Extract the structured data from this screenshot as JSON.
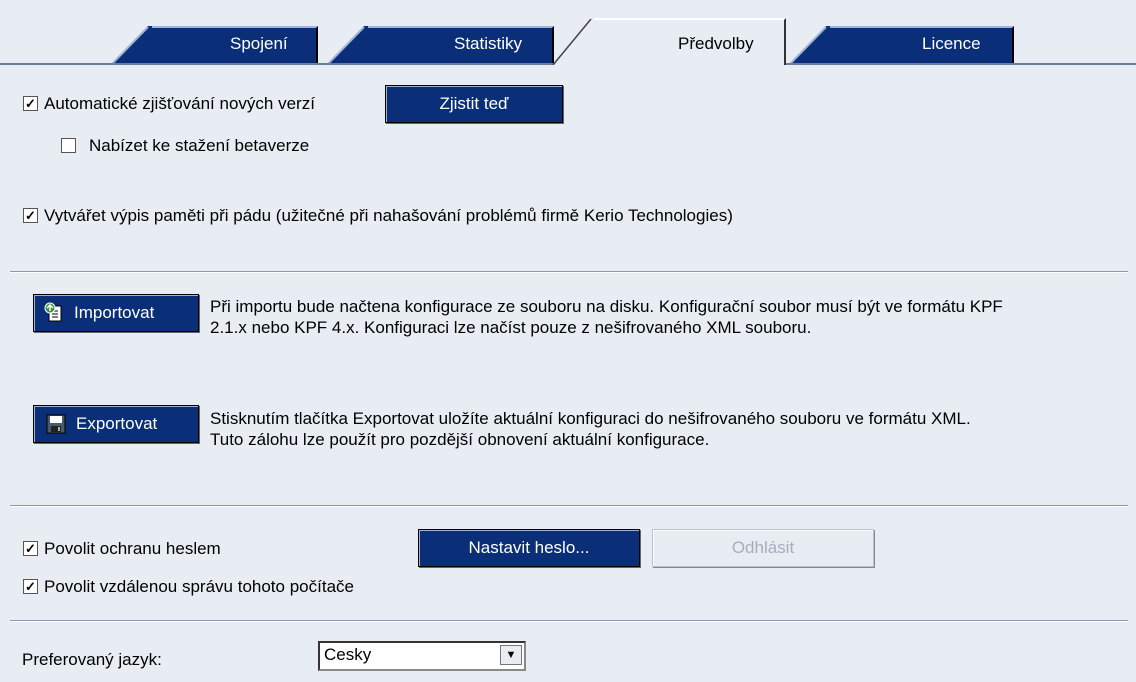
{
  "tabs": [
    {
      "label": "Spojení"
    },
    {
      "label": "Statistiky"
    },
    {
      "label": "Předvolby"
    },
    {
      "label": "Licence"
    }
  ],
  "updates": {
    "auto_check_label": "Automatické zjišťování nových verzí",
    "auto_check_checked": true,
    "check_now_label": "Zjistit teď",
    "beta_label": "Nabízet ke stažení betaverze",
    "beta_checked": false
  },
  "crash": {
    "label": "Vytvářet výpis paměti při pádu (užitečné při nahašování problémů firmě Kerio Technologies)",
    "checked": true
  },
  "import": {
    "button_label": "Importovat",
    "line1": "Při importu bude načtena konfigurace ze souboru na disku. Konfigurační soubor musí být ve formátu KPF",
    "line2": "2.1.x nebo KPF 4.x. Konfiguraci lze načíst pouze z nešifrovaného XML souboru."
  },
  "export": {
    "button_label": "Exportovat",
    "line1": "Stisknutím tlačítka Exportovat uložíte aktuální konfiguraci do nešifrovaného souboru ve formátu XML.",
    "line2": "Tuto zálohu lze použít pro pozdější obnovení aktuální konfigurace."
  },
  "security": {
    "password_label": "Povolit ochranu heslem",
    "password_checked": true,
    "set_password_label": "Nastavit heslo...",
    "logout_label": "Odhlásit",
    "remote_label": "Povolit vzdálenou správu tohoto počítače",
    "remote_checked": true
  },
  "language": {
    "label": "Preferovaný jazyk:",
    "value": "Cesky"
  },
  "colors": {
    "tab_blue": "#0a2f78",
    "background": "#e8edf4"
  }
}
